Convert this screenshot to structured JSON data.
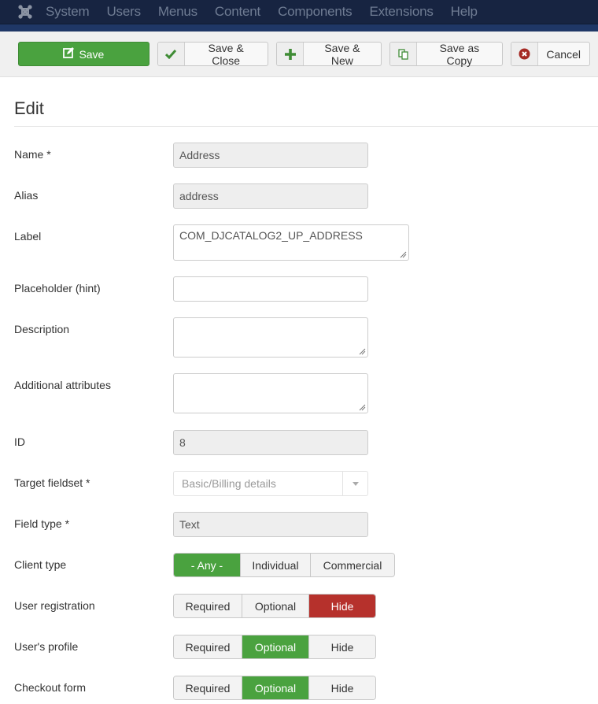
{
  "topnav": {
    "logo_icon": "joomla-logo-icon",
    "items": [
      "System",
      "Users",
      "Menus",
      "Content",
      "Components",
      "Extensions",
      "Help"
    ]
  },
  "toolbar": {
    "save": {
      "label": "Save",
      "icon": "edit-icon"
    },
    "save_close": {
      "label": "Save & Close",
      "icon": "check-icon"
    },
    "save_new": {
      "label": "Save & New",
      "icon": "plus-icon"
    },
    "save_copy": {
      "label": "Save as Copy",
      "icon": "copy-icon"
    },
    "cancel": {
      "label": "Cancel",
      "icon": "cancel-icon"
    }
  },
  "colors": {
    "accent_green": "#4aa23f",
    "danger_red": "#b6312c",
    "nav_bg": "#172441"
  },
  "page": {
    "title": "Edit"
  },
  "form": {
    "name": {
      "label": "Name *",
      "value": "Address"
    },
    "alias": {
      "label": "Alias",
      "value": "address"
    },
    "label": {
      "label": "Label",
      "value": "COM_DJCATALOG2_UP_ADDRESS"
    },
    "placeholder": {
      "label": "Placeholder (hint)",
      "value": ""
    },
    "description": {
      "label": "Description",
      "value": ""
    },
    "attributes": {
      "label": "Additional attributes",
      "value": ""
    },
    "id": {
      "label": "ID",
      "value": "8"
    },
    "fieldset": {
      "label": "Target fieldset *",
      "value": "Basic/Billing details"
    },
    "field_type": {
      "label": "Field type *",
      "value": "Text"
    },
    "client_type": {
      "label": "Client type",
      "options": [
        "- Any -",
        "Individual",
        "Commercial"
      ],
      "selected": "- Any -"
    },
    "user_registration": {
      "label": "User registration",
      "options": [
        "Required",
        "Optional",
        "Hide"
      ],
      "selected": "Hide"
    },
    "user_profile": {
      "label": "User's profile",
      "options": [
        "Required",
        "Optional",
        "Hide"
      ],
      "selected": "Optional"
    },
    "checkout_form": {
      "label": "Checkout form",
      "options": [
        "Required",
        "Optional",
        "Hide"
      ],
      "selected": "Optional"
    }
  }
}
